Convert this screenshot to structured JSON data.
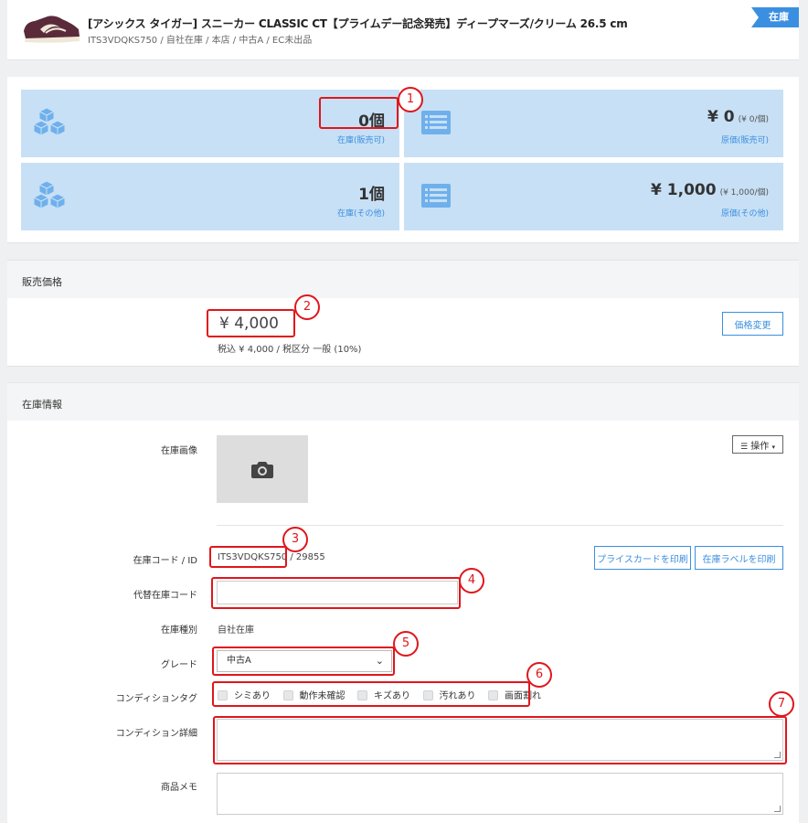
{
  "header": {
    "title": "[アシックス タイガー] スニーカー CLASSIC CT【プライムデー記念発売】ディープマーズ/クリーム 26.5 cm",
    "subtitle": "ITS3VDQKS750 / 自社在庫 / 本店 / 中古A / EC未出品",
    "status_ribbon": "在庫"
  },
  "summary": {
    "tiles": [
      {
        "value": "0個",
        "label": "在庫(販売可)",
        "icon": "cubes-icon"
      },
      {
        "value": "¥ 0",
        "unit": "(¥ 0/個)",
        "label": "原価(販売可)",
        "icon": "list-icon"
      },
      {
        "value": "1個",
        "label": "在庫(その他)",
        "icon": "cubes-icon"
      },
      {
        "value": "¥ 1,000",
        "unit": "(¥ 1,000/個)",
        "label": "原価(その他)",
        "icon": "list-icon"
      }
    ]
  },
  "sale_price": {
    "heading": "販売価格",
    "price": "¥ 4,000",
    "detail": "税込 ¥ 4,000 / 税区分 一般 (10%)",
    "change_button": "価格変更"
  },
  "stock_info": {
    "heading": "在庫情報",
    "image_label": "在庫画像",
    "ops_button": "操作",
    "code_label": "在庫コード / ID",
    "code_value": "ITS3VDQKS750",
    "id_value": " / 29855",
    "print_price_card": "プライスカードを印刷",
    "print_stock_label": "在庫ラベルを印刷",
    "alt_code_label": "代替在庫コード",
    "alt_code_value": "",
    "type_label": "在庫種別",
    "type_value": "自社在庫",
    "grade_label": "グレード",
    "grade_value": "中古A",
    "condition_tag_label": "コンディションタグ",
    "condition_tags": [
      "シミあり",
      "動作未確認",
      "キズあり",
      "汚れあり",
      "画面割れ"
    ],
    "condition_detail_label": "コンディション詳細",
    "condition_detail_value": "",
    "memo_label": "商品メモ",
    "memo_value": ""
  },
  "annotations": [
    "1",
    "2",
    "3",
    "4",
    "5",
    "6",
    "7"
  ],
  "colors": {
    "accent": "#3b8fe0",
    "tile_bg": "#c7e0f5",
    "annotation_red": "#e0161b"
  }
}
